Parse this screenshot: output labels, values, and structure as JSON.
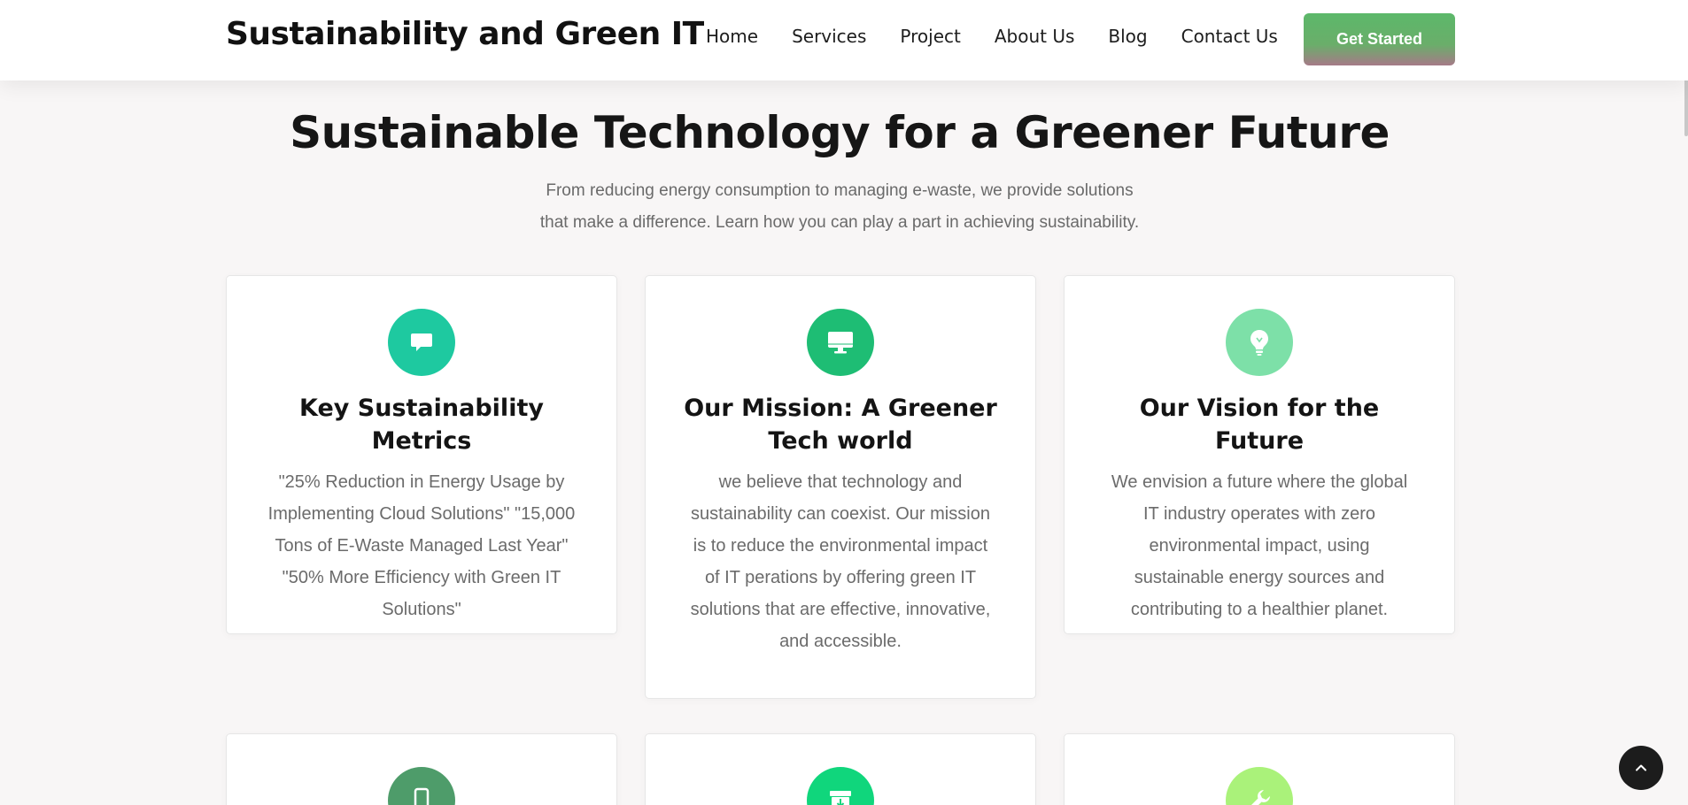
{
  "header": {
    "brand": "Sustainability and Green IT",
    "nav": [
      {
        "label": "Home"
      },
      {
        "label": "Services"
      },
      {
        "label": "Project"
      },
      {
        "label": "About Us"
      },
      {
        "label": "Blog"
      },
      {
        "label": "Contact Us"
      }
    ],
    "cta_label": "Get Started"
  },
  "hero": {
    "title": "Sustainable Technology for a Greener Future",
    "subtitle_line1": "From reducing energy consumption to managing e-waste, we provide solutions",
    "subtitle_line2": "that make a difference. Learn how you can play a part in achieving sustainability."
  },
  "cards": [
    {
      "icon": "chat-icon",
      "icon_color": "#1ec9a0",
      "title": "Key Sustainability Metrics",
      "text": "\"25% Reduction in Energy Usage by Implementing Cloud Solutions\" \"15,000 Tons of E-Waste Managed Last Year\" \"50% More Efficiency with Green IT Solutions\""
    },
    {
      "icon": "monitor-icon",
      "icon_color": "#1ebd74",
      "title": "Our Mission: A Greener Tech world",
      "text": "we believe that technology and sustainability can coexist. Our mission is to reduce the environmental impact of IT perations by offering green IT solutions that are effective, innovative, and accessible."
    },
    {
      "icon": "lightbulb-icon",
      "icon_color": "#7de0a8",
      "title": "Our Vision for the Future",
      "text": "We envision a future where the global IT industry operates with zero environmental impact, using sustainable energy sources and contributing to a healthier planet."
    },
    {
      "icon": "phone-icon",
      "icon_color": "#4e9c6a"
    },
    {
      "icon": "archive-icon",
      "icon_color": "#10d67c"
    },
    {
      "icon": "wrench-icon",
      "icon_color": "#aaf27a"
    }
  ],
  "colors": {
    "accent_green": "#5cb86a",
    "page_background": "#f8f6f6",
    "back_to_top": "#1c1c1c"
  },
  "back_to_top_icon": "chevron-up-icon"
}
